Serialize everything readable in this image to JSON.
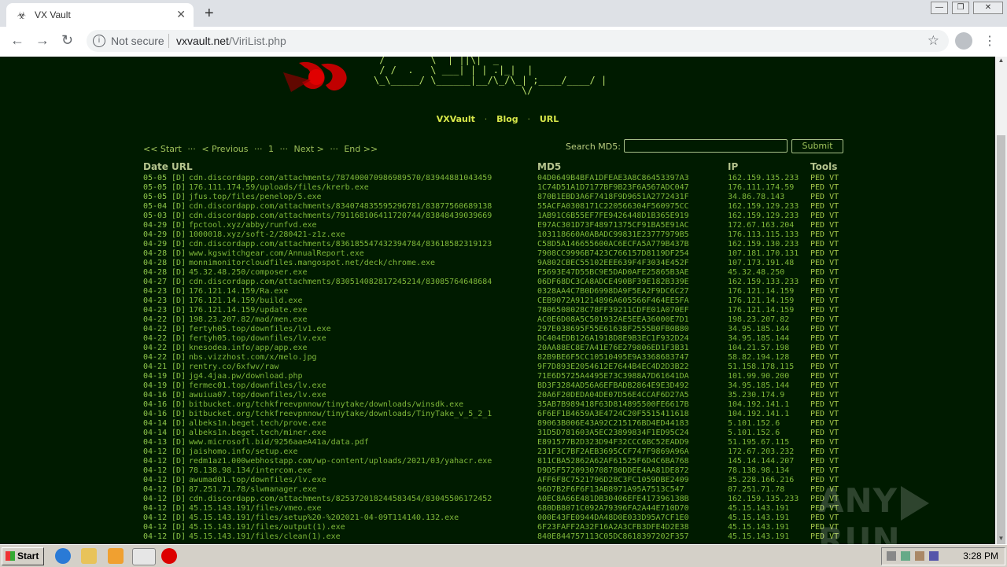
{
  "browser": {
    "tab_title": "VX Vault",
    "tab_close": "✕",
    "new_tab": "+",
    "not_secure": "Not secure",
    "url_host": "vxvault.net",
    "url_path": "/ViriList.php",
    "back": "←",
    "forward": "→",
    "reload": "↻",
    "star": "☆",
    "menu": "⋮",
    "win_min": "—",
    "win_max": "❐",
    "win_close": "✕"
  },
  "page": {
    "ascii_logo": " /        \\  | ||\\|  _\n / /  .   \\ ___| | | .|_|  |\n\\_\\_____/ \\______|__/\\_/\\_| ;____/____/ |\n                          \\/",
    "nav": [
      "VXVault",
      "Blog",
      "URL"
    ],
    "nav_dot": "·",
    "pager": {
      "start": "<< Start",
      "sep1": "···",
      "prev": "< Previous",
      "sep2": "···",
      "page": "1",
      "sep3": "···",
      "next": "Next >",
      "sep4": "···",
      "end": "End >>"
    },
    "search_label": "Search MD5:",
    "search_value": "",
    "submit_label": "Submit",
    "columns": {
      "date": "Date",
      "url": "URL",
      "md5": "MD5",
      "ip": "IP",
      "tools": "Tools"
    },
    "rows": [
      {
        "date": "05-05",
        "url": "cdn.discordapp.com/attachments/787400070986989570/83944881043459",
        "md5": "04D0649B4BFA1DFEAE3A8C86453397A3",
        "ip": "162.159.135.233"
      },
      {
        "date": "05-05",
        "url": "176.111.174.59/uploads/files/krerb.exe",
        "md5": "1C74D51A1D7177BF9B23F6A567ADC047",
        "ip": "176.111.174.59"
      },
      {
        "date": "05-05",
        "url": "jfus.top/files/penelop/5.exe",
        "md5": "870B1EBD3A6F7418F9D9651A2772431F",
        "ip": "34.86.78.143"
      },
      {
        "date": "05-04",
        "url": "cdn.discordapp.com/attachments/834074835595296781/83877560689138",
        "md5": "55ACFA0308171C220566304F560975CC",
        "ip": "162.159.129.233"
      },
      {
        "date": "05-03",
        "url": "cdn.discordapp.com/attachments/791168106411720744/83848439039669",
        "md5": "1AB91C6B55EF7FE9426448D1B365E919",
        "ip": "162.159.129.233"
      },
      {
        "date": "04-29",
        "url": "fpctool.xyz/abby/runfvd.exe",
        "md5": "E97AC301D73F48971375CF91BA5E91AC",
        "ip": "172.67.163.204"
      },
      {
        "date": "04-29",
        "url": "1000018.xyz/soft-2/280421-z1z.exe",
        "md5": "103118660A0ABADC99831E23777979B5",
        "ip": "176.113.115.133"
      },
      {
        "date": "04-29",
        "url": "cdn.discordapp.com/attachments/836185547432394784/83618582319123",
        "md5": "C58D5A146655600AC6ECFA5A779B437B",
        "ip": "162.159.130.233"
      },
      {
        "date": "04-28",
        "url": "www.kgswitchgear.com/AnnualReport.exe",
        "md5": "7908CC9996B7423C766157D8119DF254",
        "ip": "107.181.170.131"
      },
      {
        "date": "04-28",
        "url": "monnimonitorcloudfiles.mangospot.net/deck/chrome.exe",
        "md5": "9A802CBEC55102EEE639F4F3034E452F",
        "ip": "107.173.191.48"
      },
      {
        "date": "04-28",
        "url": "45.32.48.250/composer.exe",
        "md5": "F5693E47D55BC9E5DAD0AFE25865B3AE",
        "ip": "45.32.48.250"
      },
      {
        "date": "04-27",
        "url": "cdn.discordapp.com/attachments/830514082817245214/83085764648684",
        "md5": "06DF68DC3CA8ADCE490BF39E182B339E",
        "ip": "162.159.133.233"
      },
      {
        "date": "04-23",
        "url": "176.121.14.159/Ra.exe",
        "md5": "0328AA4C7B0D6998DA9F5EA2F9DC6C27",
        "ip": "176.121.14.159"
      },
      {
        "date": "04-23",
        "url": "176.121.14.159/build.exe",
        "md5": "CEB9072A91214896A605566F464EE5FA",
        "ip": "176.121.14.159"
      },
      {
        "date": "04-23",
        "url": "176.121.14.159/update.exe",
        "md5": "7806508028C78FF39211CDFE01A070EF",
        "ip": "176.121.14.159"
      },
      {
        "date": "04-22",
        "url": "198.23.207.82/mad/men.exe",
        "md5": "AC0E6D08A5C501932AE5EEA36000E7D1",
        "ip": "198.23.207.82"
      },
      {
        "date": "04-22",
        "url": "fertyh05.top/downfiles/lv1.exe",
        "md5": "297E038695F55E61638F2555B0FB0B80",
        "ip": "34.95.185.144"
      },
      {
        "date": "04-22",
        "url": "fertyh05.top/downfiles/lv.exe",
        "md5": "DC404EDB126A1918D8E9B3EC1F932D24",
        "ip": "34.95.185.144"
      },
      {
        "date": "04-22",
        "url": "knesodea.info/app/app.exe",
        "md5": "20AA88EC8E7A41E76E279806ED1F3B31",
        "ip": "104.21.57.198"
      },
      {
        "date": "04-22",
        "url": "nbs.vizzhost.com/x/melo.jpg",
        "md5": "82B9BE6F5CC10510495E9A3368683747",
        "ip": "58.82.194.128"
      },
      {
        "date": "04-21",
        "url": "rentry.co/6xfwv/raw",
        "md5": "9F7D893E2054612E7644B4EC4D2D3B22",
        "ip": "51.158.178.115"
      },
      {
        "date": "04-19",
        "url": "jg4.4jaa.pw/download.php",
        "md5": "71E6D5725A4495E73C3988A7D61641DA",
        "ip": "101.99.90.200"
      },
      {
        "date": "04-19",
        "url": "fermec01.top/downfiles/lv.exe",
        "md5": "BD3F3284AD56A6EFBADB2864E9E3D492",
        "ip": "34.95.185.144"
      },
      {
        "date": "04-16",
        "url": "awuiua07.top/downfiles/lv.exe",
        "md5": "20A6F20DEDA04DE07D56E4CCAF6D27A5",
        "ip": "35.230.174.9"
      },
      {
        "date": "04-16",
        "url": "bitbucket.org/tchkfreevpnnow/tinytake/downloads/winsdk.exe",
        "md5": "35AB7B989418F63D814895500FE6617B",
        "ip": "104.192.141.1"
      },
      {
        "date": "04-16",
        "url": "bitbucket.org/tchkfreevpnnow/tinytake/downloads/TinyTake_v_5_2_1",
        "md5": "6F6EF1B4659A3E4724C20F5515411618",
        "ip": "104.192.141.1"
      },
      {
        "date": "04-14",
        "url": "albeks1n.beget.tech/prove.exe",
        "md5": "89063B006E43A92C215176BD4ED44183",
        "ip": "5.101.152.6"
      },
      {
        "date": "04-14",
        "url": "albeks1n.beget.tech/miner.exe",
        "md5": "31D5D781603A5EC23899834F1ED95C24",
        "ip": "5.101.152.6"
      },
      {
        "date": "04-13",
        "url": "www.microsofl.bid/9256aaeA41a/data.pdf",
        "md5": "E891577B2D323D94F32CCC6BC52EADD9",
        "ip": "51.195.67.115"
      },
      {
        "date": "04-12",
        "url": "jaishomo.info/setup.exe",
        "md5": "231F3C7BF2AEB3695CCF747F9869A96A",
        "ip": "172.67.203.232"
      },
      {
        "date": "04-12",
        "url": "redm1az1.000webhostapp.com/wp-content/uploads/2021/03/yahacr.exe",
        "md5": "811CBA52862A62AF61525F6D4C6BA768",
        "ip": "145.14.144.207"
      },
      {
        "date": "04-12",
        "url": "78.138.98.134/intercom.exe",
        "md5": "D9D5F5720930708780DDEE4AA81DE872",
        "ip": "78.138.98.134"
      },
      {
        "date": "04-12",
        "url": "awumad01.top/downfiles/lv.exe",
        "md5": "AFF6F8C7521796D28C3FC1059DBE2409",
        "ip": "35.228.166.216"
      },
      {
        "date": "04-12",
        "url": "87.251.71.78/slwmanager.exe",
        "md5": "96D7B2F6F6F13AB8971A95A7513C547",
        "ip": "87.251.71.78"
      },
      {
        "date": "04-12",
        "url": "cdn.discordapp.com/attachments/825372018244583454/83045506172452",
        "md5": "A0EC8A66E481DB30406EFE417396138B",
        "ip": "162.159.135.233"
      },
      {
        "date": "04-12",
        "url": "45.15.143.191/files/vmeo.exe",
        "md5": "680DB8071C092A79396FA2A44E710D70",
        "ip": "45.15.143.191"
      },
      {
        "date": "04-12",
        "url": "45.15.143.191/files/setup%20-%202021-04-09T114140.132.exe",
        "md5": "000E43FE0944DA48D0E033D95A7CF1E0",
        "ip": "45.15.143.191"
      },
      {
        "date": "04-12",
        "url": "45.15.143.191/files/output(1).exe",
        "md5": "6F23FAFF2A32F16A2A3CFB3DFE4D2E38",
        "ip": "45.15.143.191"
      },
      {
        "date": "04-12",
        "url": "45.15.143.191/files/clean(1).exe",
        "md5": "840E844757113C05DC8618397202F357",
        "ip": "45.15.143.191"
      }
    ],
    "d_tag": "[D]",
    "tools_label": "PED VT"
  },
  "watermark": {
    "left": "ANY",
    "right": "RUN"
  },
  "taskbar": {
    "start_label": "Start",
    "clock": "3:28 PM"
  }
}
